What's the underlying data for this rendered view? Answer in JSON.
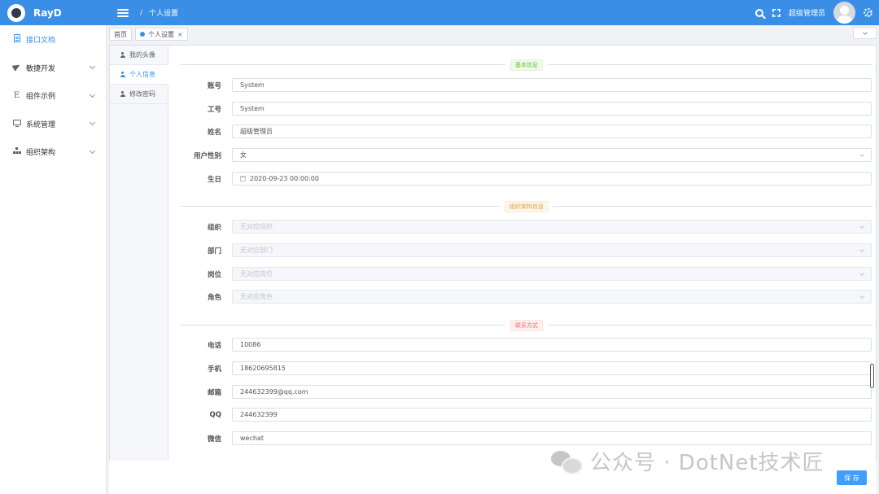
{
  "app": {
    "brand": "RayD"
  },
  "header": {
    "breadcrumb_sep": "/",
    "breadcrumb": "个人设置",
    "username": "超级管理员"
  },
  "sidebar": {
    "items": [
      {
        "label": "接口文档",
        "icon": "document-icon",
        "active": true,
        "expandable": false
      },
      {
        "label": "敏捷开发",
        "icon": "paper-plane-icon",
        "active": false,
        "expandable": true
      },
      {
        "label": "组件示例",
        "icon": "letter-e-icon",
        "active": false,
        "expandable": true
      },
      {
        "label": "系统管理",
        "icon": "monitor-icon",
        "active": false,
        "expandable": true
      },
      {
        "label": "组织架构",
        "icon": "org-chart-icon",
        "active": false,
        "expandable": true
      }
    ]
  },
  "tabs": [
    {
      "label": "首页"
    },
    {
      "label": "个人设置",
      "close": "×"
    }
  ],
  "settings_tabs": [
    {
      "label": "我的头像"
    },
    {
      "label": "个人信息",
      "active": true
    },
    {
      "label": "修改密码"
    }
  ],
  "sections": {
    "basic": "基本信息",
    "org": "组织架构信息",
    "contact": "联系方式"
  },
  "fields": {
    "account": {
      "label": "账号",
      "value": "System"
    },
    "employee_no": {
      "label": "工号",
      "value": "System"
    },
    "name": {
      "label": "姓名",
      "value": "超级管理员"
    },
    "gender": {
      "label": "用户性别",
      "value": "女"
    },
    "birthday": {
      "label": "生日",
      "value": "2020-09-23 00:00:00"
    },
    "organization": {
      "label": "组织",
      "placeholder": "无对应组织"
    },
    "department": {
      "label": "部门",
      "placeholder": "无对应部门"
    },
    "position": {
      "label": "岗位",
      "placeholder": "无对应岗位"
    },
    "role": {
      "label": "角色",
      "placeholder": "无对应角色"
    },
    "phone": {
      "label": "电话",
      "value": "10086"
    },
    "mobile": {
      "label": "手机",
      "value": "18620695815"
    },
    "email": {
      "label": "邮箱",
      "value": "244632399@qq.com"
    },
    "qq": {
      "label": "QQ",
      "value": "244632399"
    },
    "wechat": {
      "label": "微信",
      "value": "wechat"
    }
  },
  "footer": {
    "save_label": "保 存"
  },
  "watermark": {
    "text": "公众号 · DotNet技术匠"
  },
  "colors": {
    "primary": "#3a8ee6",
    "button": "#409eff"
  }
}
